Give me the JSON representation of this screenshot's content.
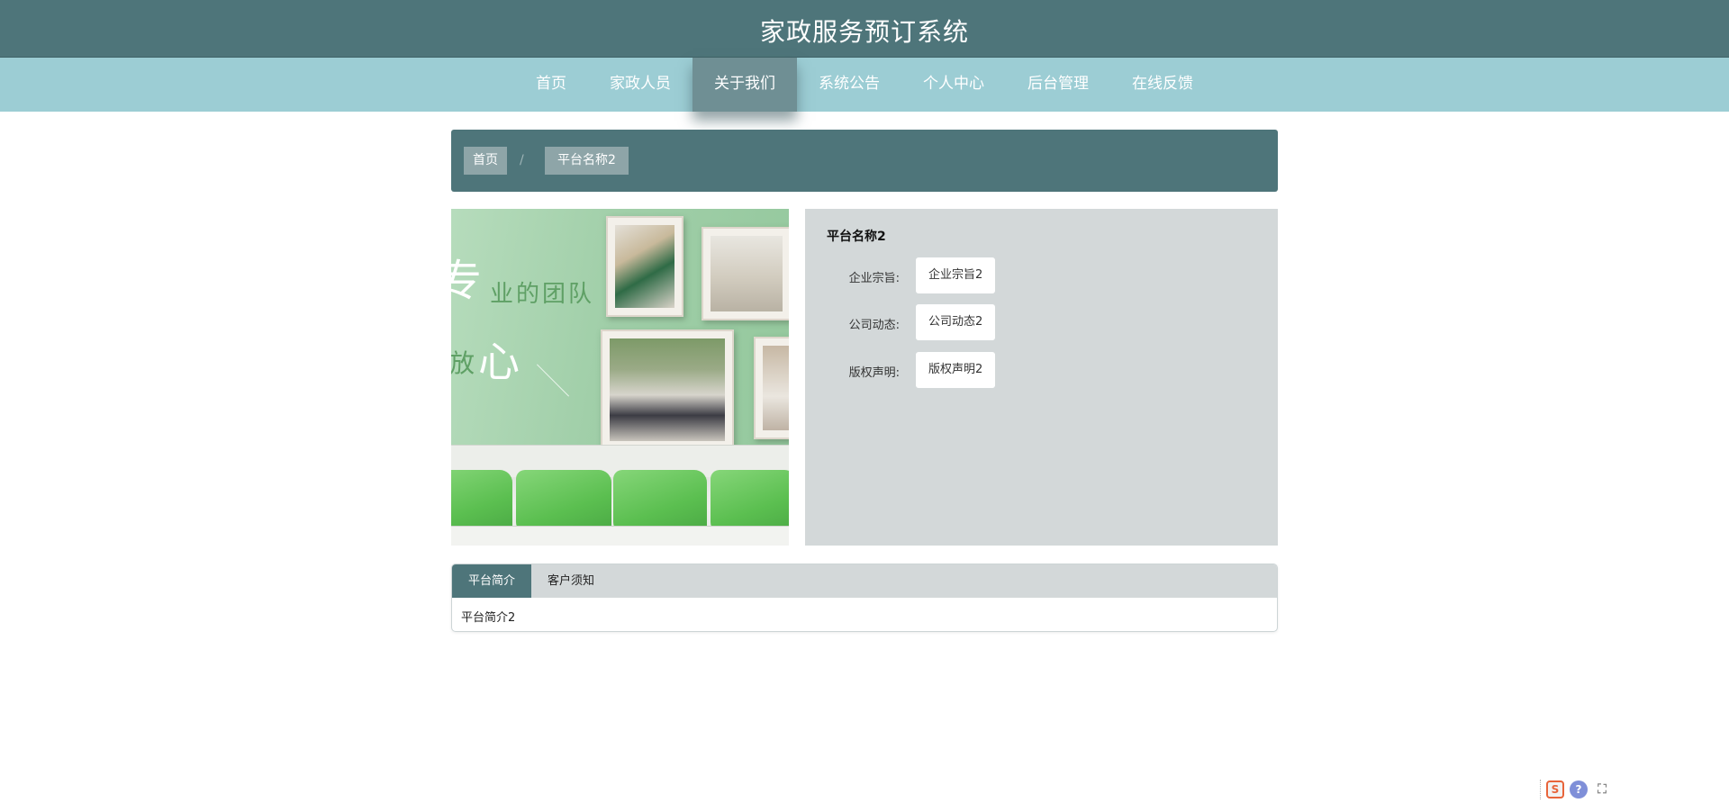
{
  "header": {
    "title": "家政服务预订系统"
  },
  "nav": {
    "items": [
      {
        "label": "首页",
        "active": false
      },
      {
        "label": "家政人员",
        "active": false
      },
      {
        "label": "关于我们",
        "active": true
      },
      {
        "label": "系统公告",
        "active": false
      },
      {
        "label": "个人中心",
        "active": false
      },
      {
        "label": "后台管理",
        "active": false
      },
      {
        "label": "在线反馈",
        "active": false
      }
    ]
  },
  "breadcrumb": {
    "home": "首页",
    "separator": "/",
    "current": "平台名称2"
  },
  "banner": {
    "slogan_char_1": "专",
    "slogan_line_1": "业的团队",
    "slogan_char_2": "放",
    "slogan_char_3": "心"
  },
  "info": {
    "title": "平台名称2",
    "rows": [
      {
        "label": "企业宗旨:",
        "value": "企业宗旨2"
      },
      {
        "label": "公司动态:",
        "value": "公司动态2"
      },
      {
        "label": "版权声明:",
        "value": "版权声明2"
      }
    ]
  },
  "tabs": {
    "items": [
      {
        "label": "平台简介",
        "active": true
      },
      {
        "label": "客户须知",
        "active": false
      }
    ],
    "content": "平台简介2"
  },
  "tray": {
    "icons": [
      "sogou-ime-icon",
      "help-icon",
      "fullscreen-icon"
    ]
  },
  "colors": {
    "header_bg": "#4e757a",
    "nav_bg": "#9ccdd4",
    "panel_bg": "#d3d8d9",
    "accent": "#4e757a"
  }
}
